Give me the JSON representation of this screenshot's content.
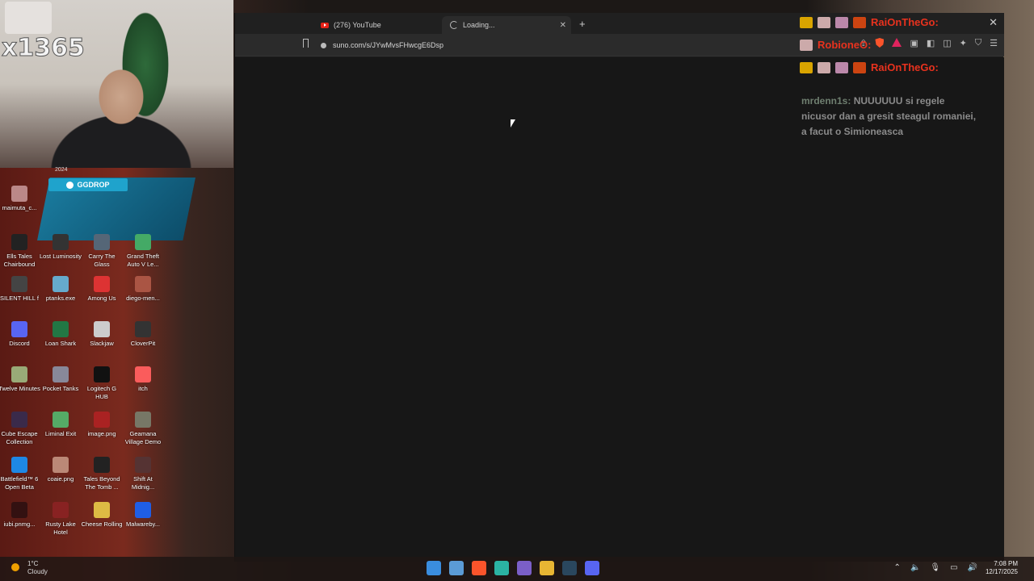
{
  "browser": {
    "tabs": [
      {
        "label": "(276) YouTube",
        "icon": "youtube-icon"
      },
      {
        "label": "Loading...",
        "icon": "spinner-icon",
        "active": true
      }
    ],
    "url": "suno.com/s/JYwMvsFHwcgE6Dsp",
    "new_tab_symbol": "+",
    "close_symbol": "✕"
  },
  "webcam": {
    "overlay_text": "x1365"
  },
  "desktop": {
    "year_label": "2024",
    "ggdrop_label": "GGDROP",
    "icons": [
      {
        "label": "maimuta_c...",
        "color": "#b88"
      },
      {
        "label": "Ells Tales Chairbound",
        "color": "#222"
      },
      {
        "label": "Lost Luminosity",
        "color": "#333"
      },
      {
        "label": "Carry The Glass",
        "color": "#567"
      },
      {
        "label": "Grand Theft Auto V Le...",
        "color": "#4a6"
      },
      {
        "label": "SILENT HILL f",
        "color": "#444"
      },
      {
        "label": "ptanks.exe",
        "color": "#6ac"
      },
      {
        "label": "Among Us",
        "color": "#d33"
      },
      {
        "label": "diego-men...",
        "color": "#a54"
      },
      {
        "label": "Discord",
        "color": "#5865f2"
      },
      {
        "label": "Loan Shark",
        "color": "#274"
      },
      {
        "label": "Slackjaw",
        "color": "#ccc"
      },
      {
        "label": "CloverPit",
        "color": "#333"
      },
      {
        "label": "Twelve Minutes",
        "color": "#9a7"
      },
      {
        "label": "Pocket Tanks",
        "color": "#889"
      },
      {
        "label": "Logitech G HUB",
        "color": "#111"
      },
      {
        "label": "itch",
        "color": "#fa5c5c"
      },
      {
        "label": "Cube Escape Collection",
        "color": "#3a2a4a"
      },
      {
        "label": "Liminal Exit",
        "color": "#5a6"
      },
      {
        "label": "image.png",
        "color": "#a22"
      },
      {
        "label": "Geamana Village Demo",
        "color": "#776"
      },
      {
        "label": "Battlefield™ 6 Open Beta",
        "color": "#1e88e5"
      },
      {
        "label": "coaie.png",
        "color": "#b87"
      },
      {
        "label": "Tales Beyond The Tomb ...",
        "color": "#222"
      },
      {
        "label": "Shift At Midnig...",
        "color": "#533"
      },
      {
        "label": "iubi.pnmg...",
        "color": "#311"
      },
      {
        "label": "Rusty Lake Hotel",
        "color": "#822"
      },
      {
        "label": "Cheese Rolling",
        "color": "#db4"
      },
      {
        "label": "Malwareby...",
        "color": "#1f5ee6"
      }
    ]
  },
  "chat": {
    "rows": [
      {
        "user": "RaiOnTheGo:"
      },
      {
        "user": "RobioneO:"
      },
      {
        "user": "RaiOnTheGo:"
      }
    ],
    "message_user": "mrdenn1s:",
    "message_text": "NUUUUUU si regele nicusor dan a gresit steagul romaniei, a facut o Simioneasca"
  },
  "taskbar": {
    "weather_temp": "1°C",
    "weather_desc": "Cloudy",
    "time": "7:08 PM",
    "date": "12/17/2025",
    "pinned": [
      "windows-start-icon",
      "file-manager-icon",
      "brave-icon",
      "copilot-icon",
      "office-icon",
      "folder-icon",
      "steam-icon",
      "discord-icon"
    ]
  }
}
